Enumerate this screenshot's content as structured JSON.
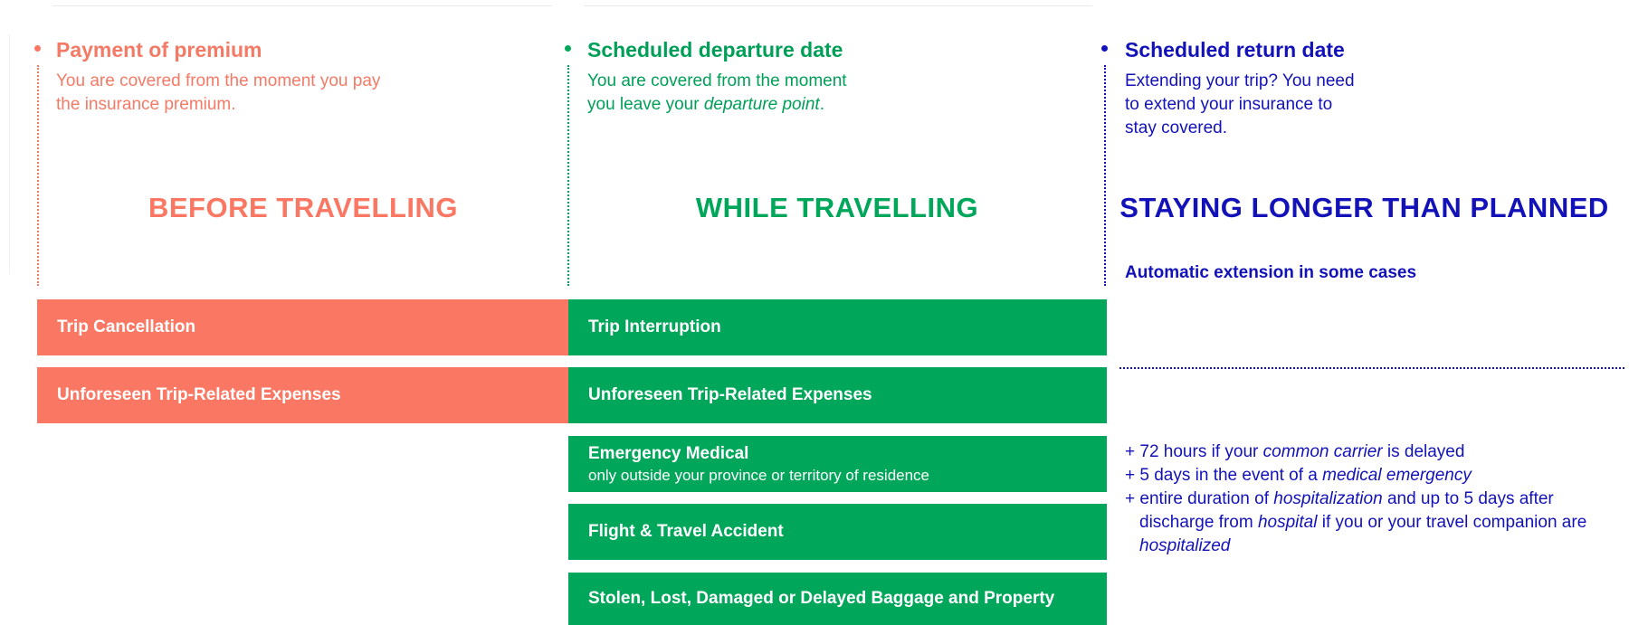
{
  "colors": {
    "coral": "#fa7863",
    "coral_text": "#f47a66",
    "green": "#00a65a",
    "green_text": "#009f58",
    "navy": "#1212b8"
  },
  "columns": [
    {
      "title": "Payment of premium",
      "desc_line1": "You are covered from the moment you pay",
      "desc_line2": "the insurance premium.",
      "phase": "BEFORE TRAVELLING"
    },
    {
      "title": "Scheduled departure date",
      "desc_line1": "You are covered from the moment",
      "desc_line2_pre": "you leave your ",
      "desc_line2_em": "departure point",
      "desc_line2_post": ".",
      "phase": "WHILE TRAVELLING"
    },
    {
      "title": "Scheduled return date",
      "desc_line1": "Extending your trip? You need",
      "desc_line2": "to extend your insurance to",
      "desc_line3": "stay covered.",
      "phase": "STAYING LONGER THAN PLANNED",
      "auto_note": "Automatic extension in some cases"
    }
  ],
  "coverages": {
    "before": [
      "Trip Cancellation",
      "Unforeseen Trip-Related Expenses"
    ],
    "while": [
      {
        "label": "Trip Interruption",
        "sub": ""
      },
      {
        "label": "Unforeseen Trip-Related Expenses",
        "sub": ""
      },
      {
        "label": "Emergency Medical",
        "sub": "only outside your province or territory of residence"
      },
      {
        "label": "Flight & Travel Accident",
        "sub": ""
      },
      {
        "label": "Stolen, Lost, Damaged or Delayed Baggage and Property",
        "sub": ""
      }
    ]
  },
  "extension": {
    "line1_pre": "+ 72 hours if your ",
    "line1_em": "common carrier",
    "line1_post": " is delayed",
    "line2_pre": "+ 5 days in the event of a ",
    "line2_em": "medical emergency",
    "line3_pre": "+ entire duration of ",
    "line3_em": "hospitalization",
    "line3_post": " and up to 5 days after",
    "line4_pre": "discharge from ",
    "line4_em": "hospital",
    "line4_post": " if you or your travel companion are",
    "line5_em": "hospitalized"
  }
}
